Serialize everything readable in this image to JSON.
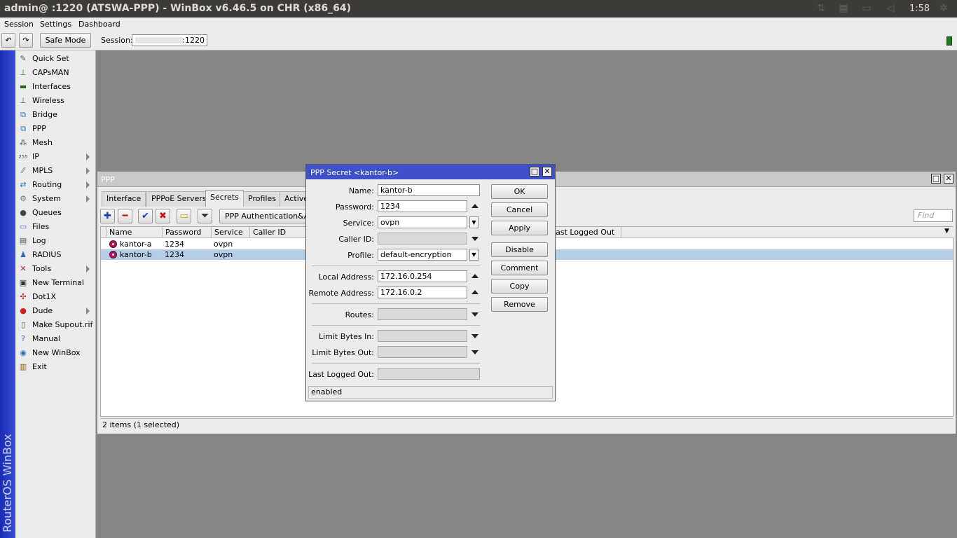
{
  "titlebar": {
    "title": "admin@                    :1220 (ATSWA-PPP) - WinBox v6.46.5 on CHR (x86_64)",
    "clock": "1:58"
  },
  "menubar": {
    "items": [
      "Session",
      "Settings",
      "Dashboard"
    ]
  },
  "toolbar": {
    "undo_icon": "undo-icon",
    "redo_icon": "redo-icon",
    "safe_mode": "Safe Mode",
    "session_label": "Session:",
    "session_value": ":1220"
  },
  "brand": "RouterOS WinBox",
  "sidemenu": {
    "items": [
      {
        "label": "Quick Set",
        "icon": "wand-icon"
      },
      {
        "label": "CAPsMAN",
        "icon": "antenna-icon"
      },
      {
        "label": "Interfaces",
        "icon": "interfaces-icon"
      },
      {
        "label": "Wireless",
        "icon": "wireless-icon"
      },
      {
        "label": "Bridge",
        "icon": "bridge-icon"
      },
      {
        "label": "PPP",
        "icon": "ppp-icon"
      },
      {
        "label": "Mesh",
        "icon": "mesh-icon"
      },
      {
        "label": "IP",
        "icon": "ip-icon"
      },
      {
        "label": "MPLS",
        "icon": "mpls-icon"
      },
      {
        "label": "Routing",
        "icon": "routing-icon"
      },
      {
        "label": "System",
        "icon": "gear-icon"
      },
      {
        "label": "Queues",
        "icon": "queues-icon"
      },
      {
        "label": "Files",
        "icon": "folder-icon"
      },
      {
        "label": "Log",
        "icon": "log-icon"
      },
      {
        "label": "RADIUS",
        "icon": "radius-icon"
      },
      {
        "label": "Tools",
        "icon": "tools-icon"
      },
      {
        "label": "New Terminal",
        "icon": "terminal-icon"
      },
      {
        "label": "Dot1X",
        "icon": "dot1x-icon"
      },
      {
        "label": "Dude",
        "icon": "dude-icon"
      },
      {
        "label": "Make Supout.rif",
        "icon": "document-icon"
      },
      {
        "label": "Manual",
        "icon": "help-icon"
      },
      {
        "label": "New WinBox",
        "icon": "globe-icon"
      },
      {
        "label": "Exit",
        "icon": "exit-icon"
      }
    ]
  },
  "ppp": {
    "title": "PPP",
    "tabs": [
      "Interface",
      "PPPoE Servers",
      "Secrets",
      "Profiles",
      "Active"
    ],
    "auth_button": "PPP Authentication&Accounting",
    "find_placeholder": "Find",
    "columns": [
      "Name",
      "Password",
      "Service",
      "Caller ID",
      "Last Logged Out"
    ],
    "rows": [
      {
        "name": "kantor-a",
        "password": "1234",
        "service": "ovpn",
        "caller_id": ""
      },
      {
        "name": "kantor-b",
        "password": "1234",
        "service": "ovpn",
        "caller_id": ""
      }
    ],
    "status": "2 items (1 selected)"
  },
  "dialog": {
    "title": "PPP Secret <kantor-b>",
    "fields": {
      "name_label": "Name:",
      "name": "kantor-b",
      "password_label": "Password:",
      "password": "1234",
      "service_label": "Service:",
      "service": "ovpn",
      "caller_id_label": "Caller ID:",
      "caller_id": "",
      "profile_label": "Profile:",
      "profile": "default-encryption",
      "local_address_label": "Local Address:",
      "local_address": "172.16.0.254",
      "remote_address_label": "Remote Address:",
      "remote_address": "172.16.0.2",
      "routes_label": "Routes:",
      "routes": "",
      "limit_in_label": "Limit Bytes In:",
      "limit_in": "",
      "limit_out_label": "Limit Bytes Out:",
      "limit_out": "",
      "last_logged_out_label": "Last Logged Out:",
      "last_logged_out": ""
    },
    "buttons": [
      "OK",
      "Cancel",
      "Apply",
      "Disable",
      "Comment",
      "Copy",
      "Remove"
    ],
    "status": "enabled"
  },
  "colors": {
    "brand_blue": "#3f50c9",
    "selected_row": "#b6cde8",
    "secret_icon": "#b4125a",
    "status_led": "#1f7a1f"
  }
}
